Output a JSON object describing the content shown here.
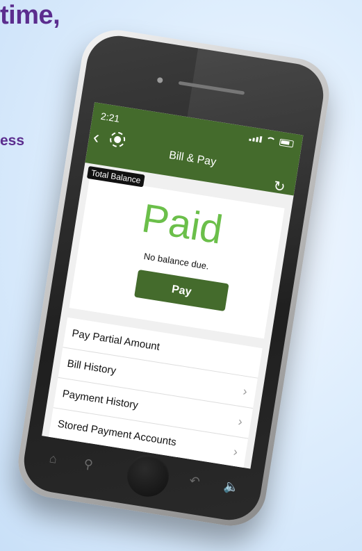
{
  "promo": {
    "headline": "time,",
    "subtext": "ess"
  },
  "status_bar": {
    "time": "2:21"
  },
  "nav": {
    "back_icon": "chevron-left-icon",
    "logo_icon": "company-logo-icon",
    "title": "Bill & Pay",
    "refresh_icon": "refresh-icon"
  },
  "balance": {
    "badge": "Total Balance",
    "status": "Paid",
    "message": "No balance due.",
    "pay_label": "Pay"
  },
  "menu": {
    "items": [
      {
        "label": "Pay Partial Amount",
        "chevron": ""
      },
      {
        "label": "Bill History",
        "chevron": "›"
      },
      {
        "label": "Payment History",
        "chevron": "›"
      },
      {
        "label": "Stored Payment Accounts",
        "chevron": "›"
      }
    ]
  },
  "bottom_bar": {
    "icons": [
      "home-icon",
      "search-icon",
      "back-icon",
      "volume-icon"
    ]
  },
  "colors": {
    "nav_green": "#446b2c",
    "paid_green": "#6bbf4a",
    "promo_purple": "#5b2d8e"
  }
}
